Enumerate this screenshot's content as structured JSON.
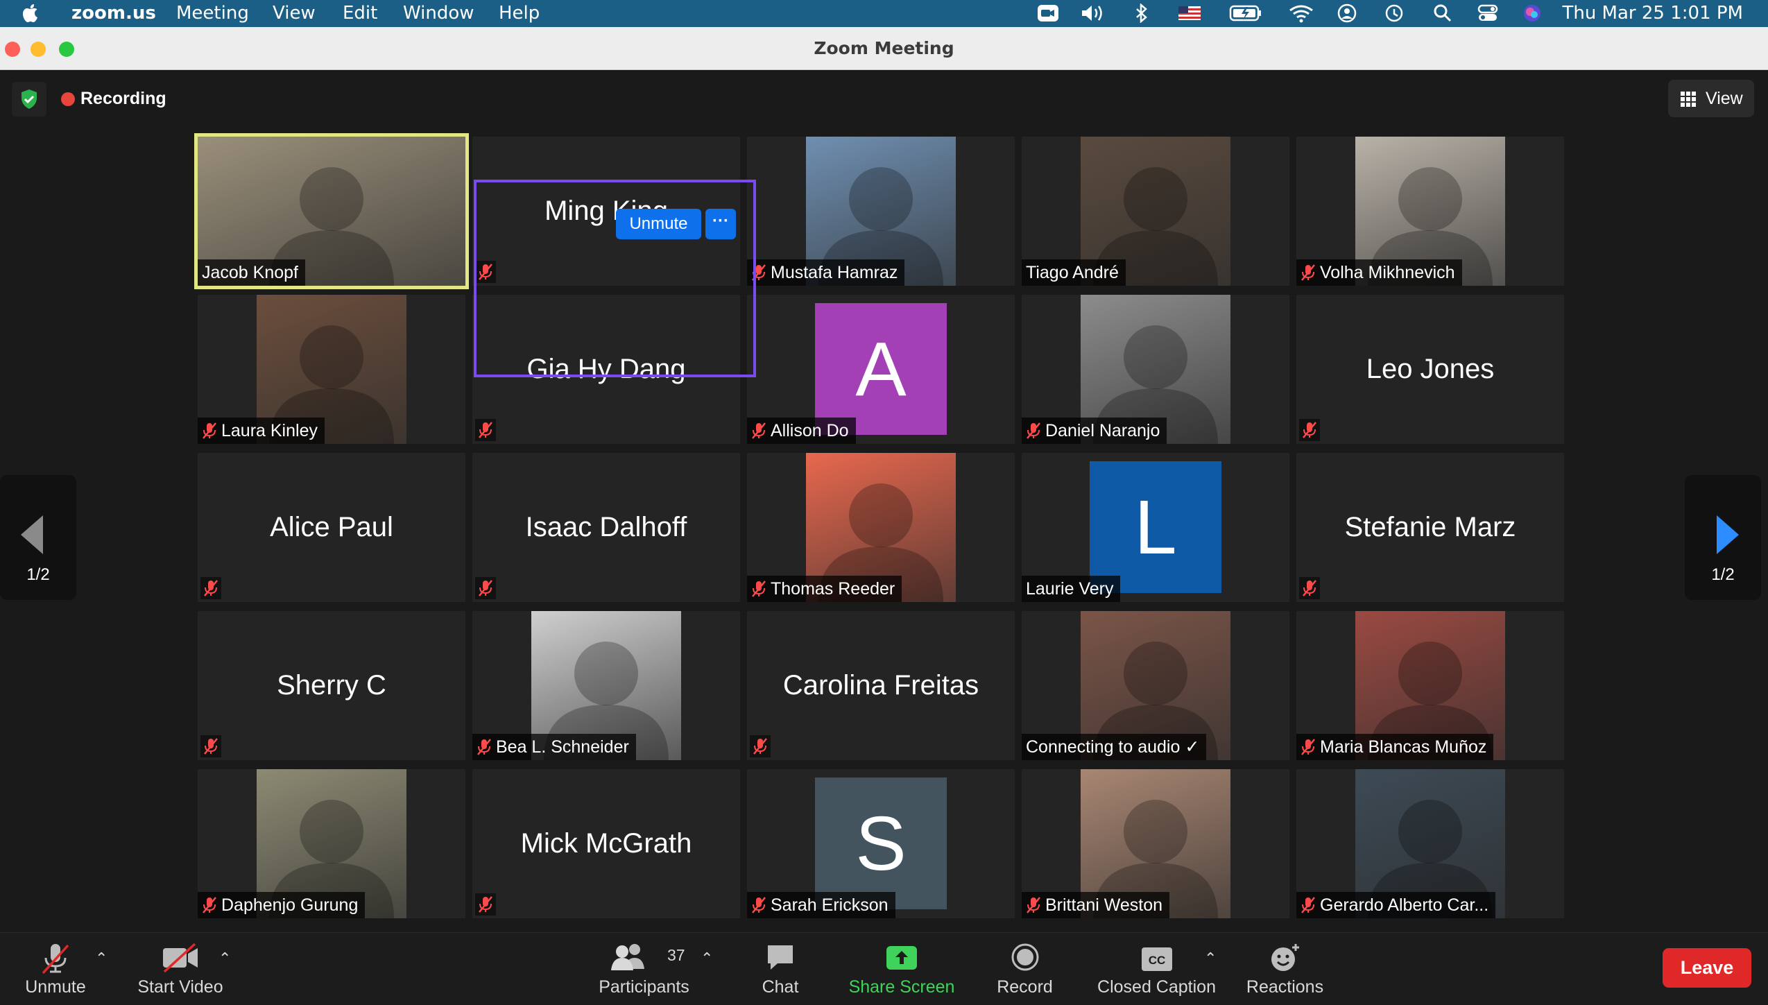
{
  "menubar": {
    "app": "zoom.us",
    "items": [
      "Meeting",
      "View",
      "Edit",
      "Window",
      "Help"
    ],
    "clock": "Thu Mar 25  1:01 PM"
  },
  "window": {
    "title": "Zoom Meeting"
  },
  "meeting": {
    "recording_label": "Recording",
    "view_label": "View",
    "page_left": "1/2",
    "page_right": "1/2",
    "hover_unmute": "Unmute",
    "hover_more": "···"
  },
  "participants": [
    {
      "name": "Jacob Knopf",
      "kind": "photo",
      "muted": false,
      "color": "#9a8f7a"
    },
    {
      "name": "Ming King",
      "kind": "name",
      "muted": true
    },
    {
      "name": "Mustafa Hamraz",
      "kind": "photo",
      "muted": true,
      "color": "#6f8fb1"
    },
    {
      "name": "Tiago André",
      "kind": "photo",
      "muted": false,
      "color": "#5a4a3e"
    },
    {
      "name": "Volha Mikhnevich",
      "kind": "photo",
      "muted": true,
      "color": "#b9b2a8"
    },
    {
      "name": "Laura Kinley",
      "kind": "photo",
      "muted": true,
      "color": "#6b4e3c"
    },
    {
      "name": "Gia Hy Dang",
      "kind": "name",
      "muted": true
    },
    {
      "name": "Allison Do",
      "kind": "avatar",
      "letter": "A",
      "muted": true,
      "color": "#a340b6"
    },
    {
      "name": "Daniel Naranjo",
      "kind": "photo",
      "muted": true,
      "color": "#8c8c8c"
    },
    {
      "name": "Leo Jones",
      "kind": "name",
      "muted": true
    },
    {
      "name": "Alice Paul",
      "kind": "name",
      "muted": true
    },
    {
      "name": "Isaac Dalhoff",
      "kind": "name",
      "muted": true
    },
    {
      "name": "Thomas Reeder",
      "kind": "photo",
      "muted": true,
      "color": "#e8684e"
    },
    {
      "name": "Laurie Very",
      "kind": "avatar",
      "letter": "L",
      "muted": false,
      "color": "#0f5aa7"
    },
    {
      "name": "Stefanie Marz",
      "kind": "name",
      "muted": true
    },
    {
      "name": "Sherry C",
      "kind": "name",
      "muted": true
    },
    {
      "name": "Bea L. Schneider",
      "kind": "photo",
      "muted": true,
      "color": "#cfcfcf"
    },
    {
      "name": "Carolina Freitas",
      "kind": "name",
      "muted": true
    },
    {
      "name": "Connecting to audio ✓",
      "kind": "photo",
      "muted": false,
      "color": "#7b5548"
    },
    {
      "name": "Maria Blancas Muñoz",
      "kind": "photo",
      "muted": true,
      "color": "#9a4a42"
    },
    {
      "name": "Daphenjo Gurung",
      "kind": "photo",
      "muted": true,
      "color": "#8d8a73"
    },
    {
      "name": "Mick McGrath",
      "kind": "name",
      "muted": true
    },
    {
      "name": "Sarah Erickson",
      "kind": "avatar",
      "letter": "S",
      "muted": true,
      "color": "#44545f"
    },
    {
      "name": "Brittani Weston",
      "kind": "photo",
      "muted": true,
      "color": "#a98672"
    },
    {
      "name": "Gerardo Alberto Car...",
      "kind": "photo",
      "muted": true,
      "color": "#3d4a55"
    }
  ],
  "toolbar": {
    "unmute": "Unmute",
    "start_video": "Start Video",
    "participants": "Participants",
    "participants_count": "37",
    "chat": "Chat",
    "share_screen": "Share Screen",
    "record": "Record",
    "closed_caption": "Closed Caption",
    "reactions": "Reactions",
    "leave": "Leave"
  }
}
